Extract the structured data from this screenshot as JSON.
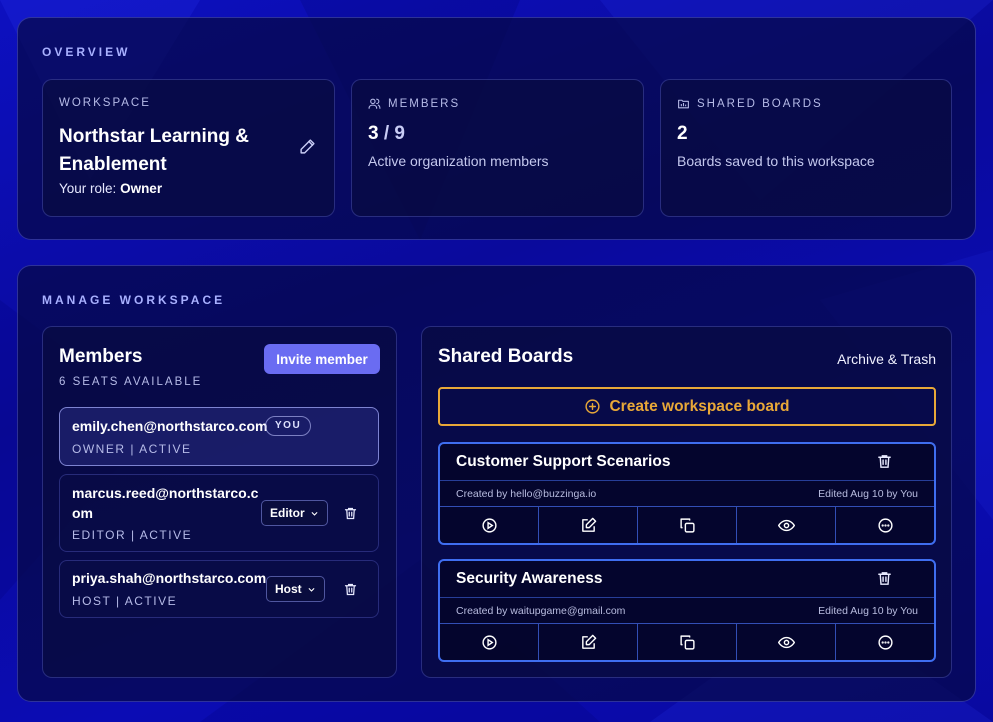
{
  "overview": {
    "title": "OVERVIEW",
    "workspace": {
      "label": "WORKSPACE",
      "name": "Northstar Learning & Enablement",
      "role_prefix": "Your role:",
      "role": "Owner"
    },
    "members": {
      "label": "MEMBERS",
      "count": "3",
      "total": "/ 9",
      "subtitle": "Active organization members"
    },
    "shared_boards": {
      "label": "SHARED BOARDS",
      "count": "2",
      "subtitle": "Boards saved to this workspace"
    }
  },
  "manage": {
    "title": "MANAGE WORKSPACE",
    "members_panel": {
      "title": "Members",
      "seats": "6 SEATS AVAILABLE",
      "invite_label": "Invite member",
      "items": [
        {
          "email": "emily.chen@northstarco.com",
          "status": "OWNER | ACTIVE",
          "badge": "YOU"
        },
        {
          "email": "marcus.reed@northstarco.com",
          "status": "EDITOR | ACTIVE",
          "role": "Editor"
        },
        {
          "email": "priya.shah@northstarco.com",
          "status": "HOST | ACTIVE",
          "role": "Host"
        }
      ]
    },
    "boards_panel": {
      "title": "Shared Boards",
      "archive_label": "Archive & Trash",
      "create_label": "Create workspace board",
      "boards": [
        {
          "title": "Customer Support Scenarios",
          "creator": "Created by hello@buzzinga.io",
          "edited": "Edited Aug 10 by You"
        },
        {
          "title": "Security Awareness",
          "creator": "Created by waitupgame@gmail.com",
          "edited": "Edited Aug 10 by You"
        }
      ]
    }
  },
  "colors": {
    "accent": "#6a6cf2",
    "create": "#e8a838",
    "board_border": "#3f6ef0"
  },
  "icons": [
    "pencil-icon",
    "users-icon",
    "folder-icon",
    "trash-icon",
    "chevron-down-icon",
    "plus-circle-icon",
    "play-icon",
    "edit-icon",
    "copy-icon",
    "eye-icon",
    "more-icon"
  ]
}
